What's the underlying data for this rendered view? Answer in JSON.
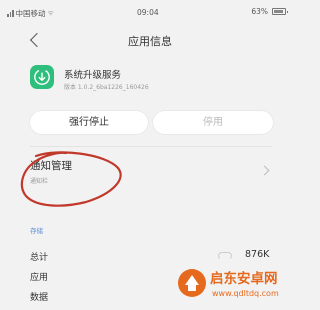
{
  "status_bar": {
    "carrier": "中国移动",
    "time": "09:04",
    "battery": "63%"
  },
  "header": {
    "title": "应用信息"
  },
  "app": {
    "name": "系统升级服务",
    "version": "版本 1.0.2_6ba1226_160426",
    "icon": "update-icon",
    "icon_color": "#2fbf7d"
  },
  "actions": {
    "force_stop": "强行停止",
    "disable": "停用"
  },
  "notification": {
    "title": "通知管理",
    "subtitle": "通知栏"
  },
  "storage": {
    "section_label": "存储",
    "total_label": "总计",
    "total_value": "876K",
    "app_label": "应用",
    "data_label": "数据"
  },
  "watermark": {
    "title": "启东安卓网",
    "url": "www.qdltdq.com"
  },
  "colors": {
    "annotation": "#c0392b",
    "accent": "#5b8fd6",
    "watermark": "#e56a1e"
  }
}
